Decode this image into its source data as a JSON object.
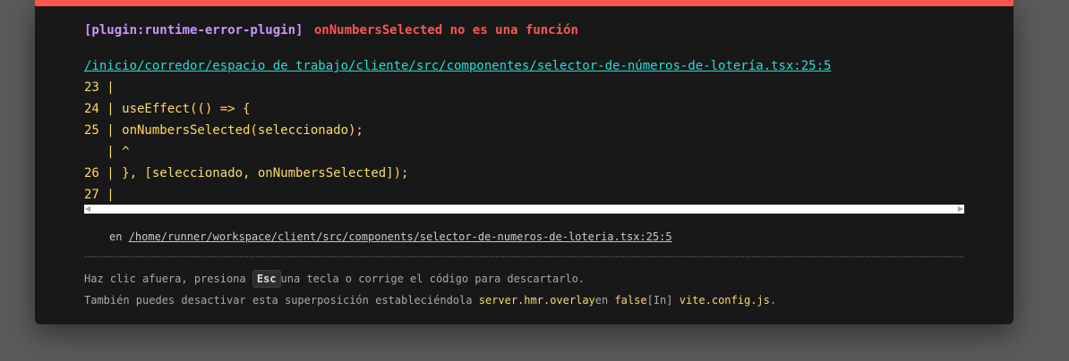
{
  "error": {
    "plugin": "[plugin:runtime-error-plugin]",
    "message": "onNumbersSelected no es una función",
    "file_link": "/inicio/corredor/espacio de trabajo/cliente/src/componentes/selector-de-números-de-lotería.tsx:25:5"
  },
  "code_frame": {
    "lines": [
      "23 |",
      "24 | useEffect(() => {",
      "25 | onNumbersSelected(seleccionado);",
      "   | ^",
      "26 | }, [seleccionado, onNumbersSelected]);",
      "27 |"
    ]
  },
  "stack": {
    "prefix": "en",
    "location": "/home/runner/workspace/client/src/components/selector-de-numeros-de-loteria.tsx:25:5"
  },
  "tips": {
    "line1_a": "Haz clic afuera, presiona",
    "esc_key": "Esc",
    "line1_b": "una tecla o corrige el código para descartarlo.",
    "line2_a": "También puedes desactivar esta superposición estableciéndola",
    "config_key": "server.hmr.overlay",
    "line2_b": "en",
    "false_value": "false",
    "line2_c": "[In]",
    "config_file": "vite.config.js",
    "line2_end": "."
  },
  "colors": {
    "accent_red": "#ff5555",
    "plugin_purple": "#cb95ff",
    "link_cyan": "#2dd9da",
    "code_yellow": "#fdd867"
  }
}
